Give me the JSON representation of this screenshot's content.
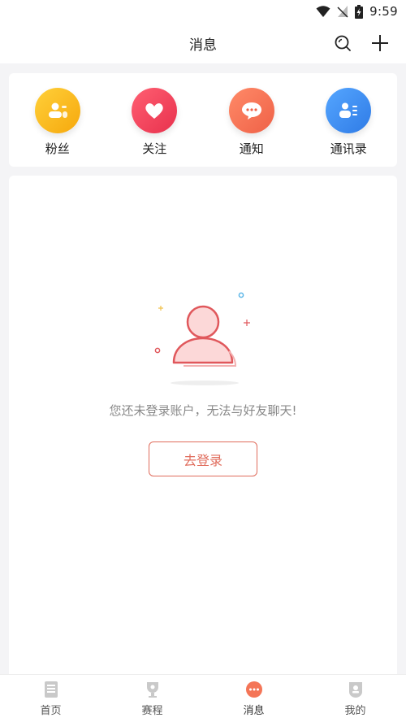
{
  "status_bar": {
    "time": "9:59"
  },
  "header": {
    "title": "消息"
  },
  "shortcuts": [
    {
      "label": "粉丝",
      "icon": "fans-icon",
      "color": "#fbb919"
    },
    {
      "label": "关注",
      "icon": "heart-icon",
      "color": "#f0455a"
    },
    {
      "label": "通知",
      "icon": "chat-bubble-icon",
      "color": "#f47557"
    },
    {
      "label": "通讯录",
      "icon": "contacts-icon",
      "color": "#3f8ff0"
    }
  ],
  "empty_state": {
    "message": "您还未登录账户，无法与好友聊天!",
    "button_label": "去登录",
    "accent_color": "#e06c5c"
  },
  "tabs": [
    {
      "label": "首页",
      "icon": "home-doc-icon",
      "active": false
    },
    {
      "label": "赛程",
      "icon": "trophy-icon",
      "active": false
    },
    {
      "label": "消息",
      "icon": "message-icon",
      "active": true
    },
    {
      "label": "我的",
      "icon": "profile-icon",
      "active": false
    }
  ]
}
